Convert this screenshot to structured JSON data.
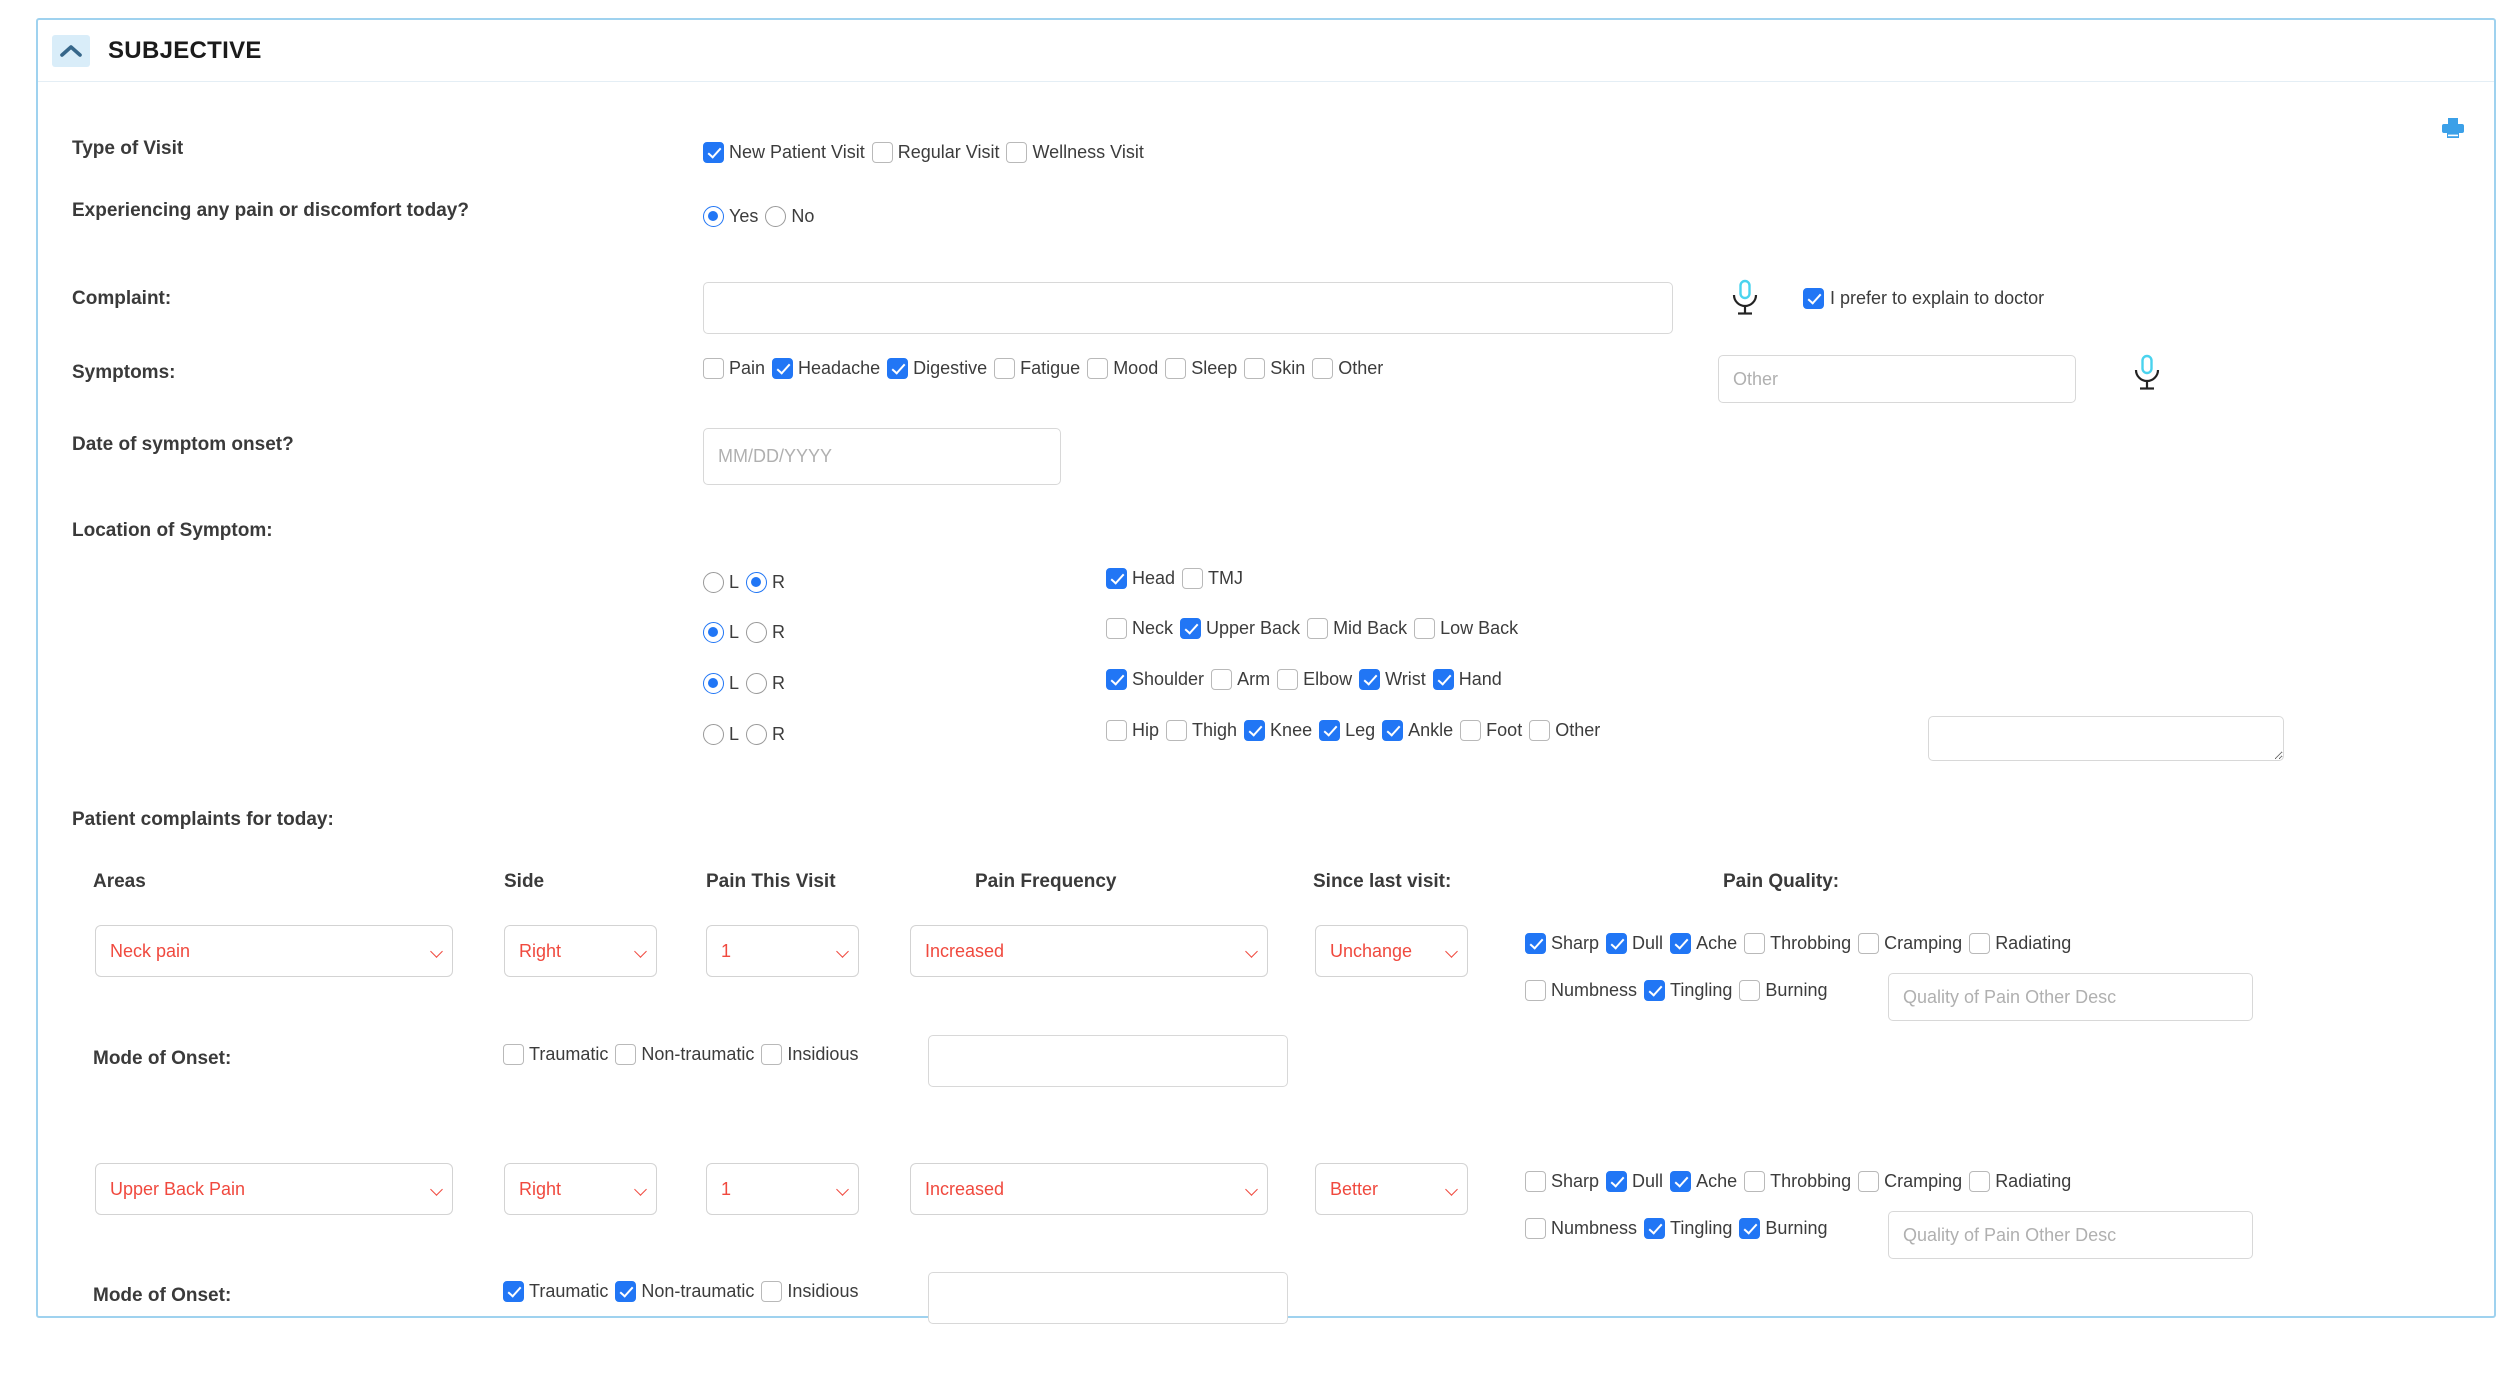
{
  "panel": {
    "title": "SUBJECTIVE",
    "collapse_icon": "chevron-up-icon",
    "print_icon": "printer-icon",
    "accent_border": "#9fd2ef",
    "accent_red": "#f0493e",
    "accent_blue": "#2176f5"
  },
  "type_of_visit": {
    "label": "Type of Visit",
    "options": [
      {
        "label": "New Patient Visit",
        "checked": true
      },
      {
        "label": "Regular Visit",
        "checked": false
      },
      {
        "label": "Wellness Visit",
        "checked": false
      }
    ]
  },
  "pain_today": {
    "label": "Experiencing any pain or discomfort today?",
    "options": [
      {
        "label": "Yes",
        "selected": true
      },
      {
        "label": "No",
        "selected": false
      }
    ]
  },
  "complaint": {
    "label": "Complaint:",
    "value": "",
    "placeholder": "",
    "mic_icon": "microphone-icon",
    "prefer_label": "I prefer to explain to doctor",
    "prefer_checked": true
  },
  "symptoms": {
    "label": "Symptoms:",
    "options": [
      {
        "label": "Pain",
        "checked": false
      },
      {
        "label": "Headache",
        "checked": true
      },
      {
        "label": "Digestive",
        "checked": true
      },
      {
        "label": "Fatigue",
        "checked": false
      },
      {
        "label": "Mood",
        "checked": false
      },
      {
        "label": "Sleep",
        "checked": false
      },
      {
        "label": "Skin",
        "checked": false
      },
      {
        "label": "Other",
        "checked": false
      }
    ],
    "other_value": "",
    "other_placeholder": "Other",
    "mic_icon": "microphone-icon"
  },
  "symptom_onset": {
    "label": "Date of symptom onset?",
    "value": "",
    "placeholder": "MM/DD/YYYY"
  },
  "location_of_symptom": {
    "label": "Location of Symptom:",
    "side_left_label": "L",
    "side_right_label": "R",
    "rows": [
      {
        "side": "R",
        "parts": [
          {
            "label": "Head",
            "checked": true
          },
          {
            "label": "TMJ",
            "checked": false
          }
        ]
      },
      {
        "side": "L",
        "parts": [
          {
            "label": "Neck",
            "checked": false
          },
          {
            "label": "Upper Back",
            "checked": true
          },
          {
            "label": "Mid Back",
            "checked": false
          },
          {
            "label": "Low Back",
            "checked": false
          }
        ]
      },
      {
        "side": "L",
        "parts": [
          {
            "label": "Shoulder",
            "checked": true
          },
          {
            "label": "Arm",
            "checked": false
          },
          {
            "label": "Elbow",
            "checked": false
          },
          {
            "label": "Wrist",
            "checked": true
          },
          {
            "label": "Hand",
            "checked": true
          }
        ]
      },
      {
        "side": "",
        "parts": [
          {
            "label": "Hip",
            "checked": false
          },
          {
            "label": "Thigh",
            "checked": false
          },
          {
            "label": "Knee",
            "checked": true
          },
          {
            "label": "Leg",
            "checked": true
          },
          {
            "label": "Ankle",
            "checked": true
          },
          {
            "label": "Foot",
            "checked": false
          },
          {
            "label": "Other",
            "checked": false
          }
        ],
        "other_value": ""
      }
    ]
  },
  "complaints_today": {
    "section_label": "Patient complaints for today:",
    "headers": {
      "areas": "Areas",
      "side": "Side",
      "pain_this_visit": "Pain This Visit",
      "pain_frequency": "Pain Frequency",
      "since_last_visit": "Since last visit:",
      "pain_quality": "Pain Quality:"
    },
    "mode_of_onset_label": "Mode of Onset:",
    "quality_other_placeholder": "Quality of Pain Other Desc",
    "rows": [
      {
        "area": "Neck pain",
        "side": "Right",
        "pain_this_visit": "1",
        "pain_frequency": "Increased",
        "since_last_visit": "Unchange",
        "quality_line1": [
          {
            "label": "Sharp",
            "checked": true
          },
          {
            "label": "Dull",
            "checked": true
          },
          {
            "label": "Ache",
            "checked": true
          },
          {
            "label": "Throbbing",
            "checked": false
          },
          {
            "label": "Cramping",
            "checked": false
          },
          {
            "label": "Radiating",
            "checked": false
          }
        ],
        "quality_line2": [
          {
            "label": "Numbness",
            "checked": false
          },
          {
            "label": "Tingling",
            "checked": true
          },
          {
            "label": "Burning",
            "checked": false
          }
        ],
        "quality_other_value": "",
        "mode_of_onset": [
          {
            "label": "Traumatic",
            "checked": false
          },
          {
            "label": "Non-traumatic",
            "checked": false
          },
          {
            "label": "Insidious",
            "checked": false
          }
        ],
        "mode_of_onset_note": ""
      },
      {
        "area": "Upper Back Pain",
        "side": "Right",
        "pain_this_visit": "1",
        "pain_frequency": "Increased",
        "since_last_visit": "Better",
        "quality_line1": [
          {
            "label": "Sharp",
            "checked": false
          },
          {
            "label": "Dull",
            "checked": true
          },
          {
            "label": "Ache",
            "checked": true
          },
          {
            "label": "Throbbing",
            "checked": false
          },
          {
            "label": "Cramping",
            "checked": false
          },
          {
            "label": "Radiating",
            "checked": false
          }
        ],
        "quality_line2": [
          {
            "label": "Numbness",
            "checked": false
          },
          {
            "label": "Tingling",
            "checked": true
          },
          {
            "label": "Burning",
            "checked": true
          }
        ],
        "quality_other_value": "",
        "mode_of_onset": [
          {
            "label": "Traumatic",
            "checked": true
          },
          {
            "label": "Non-traumatic",
            "checked": true
          },
          {
            "label": "Insidious",
            "checked": false
          }
        ],
        "mode_of_onset_note": ""
      }
    ]
  }
}
